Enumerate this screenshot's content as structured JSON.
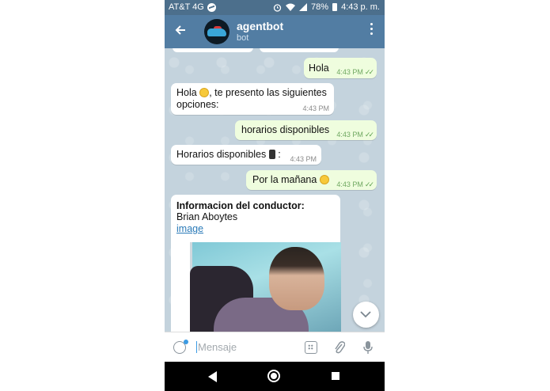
{
  "status": {
    "carrier": "AT&T 4G",
    "battery": "78%",
    "time": "4:43 p. m."
  },
  "header": {
    "title": "agentbot",
    "subtitle": "bot"
  },
  "messages": [
    {
      "dir": "out",
      "text": "Hola",
      "time": "4:43 PM"
    },
    {
      "dir": "in",
      "text_a": "Hola ",
      "emoji": "grin-emoji",
      "text_b": ", te presento las siguientes opciones:",
      "time": "4:43 PM"
    },
    {
      "dir": "out",
      "text": "horarios disponibles",
      "time": "4:43 PM"
    },
    {
      "dir": "in",
      "text_a": "Horarios disponibles ",
      "emoji": "watch-emoji",
      "text_b": " :",
      "time": "4:43 PM"
    },
    {
      "dir": "out",
      "text": "Por la mañana ",
      "emoji": "sweat-smile-emoji",
      "time": "4:43 PM"
    },
    {
      "dir": "in",
      "heading": "Informacion del conductor:",
      "name": "Brian Aboytes",
      "link": "image"
    }
  ],
  "input": {
    "placeholder": "Mensaje"
  },
  "colors": {
    "appbar": "#527da3",
    "statusbar": "#4c6f8c",
    "outgoing_bubble": "#effdde",
    "incoming_bubble": "#ffffff",
    "link": "#2a7ab8"
  }
}
